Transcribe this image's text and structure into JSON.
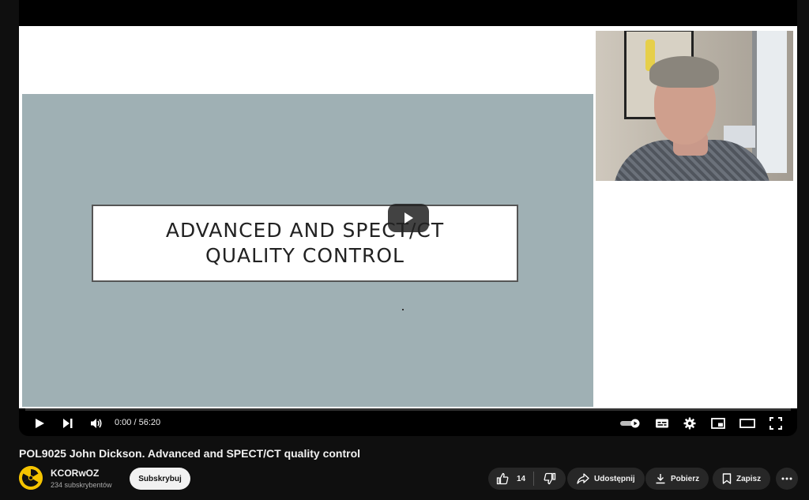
{
  "player": {
    "slide": {
      "title_line1": "ADVANCED AND SPECT/CT",
      "title_line2": "QUALITY CONTROL"
    },
    "progress": 0.0,
    "time": {
      "current": "0:00",
      "separator": " / ",
      "duration": "56:20"
    },
    "icons": {
      "play": "play-icon",
      "next": "skip-next-icon",
      "volume": "volume-icon",
      "autoplay": "autoplay-toggle-icon",
      "subtitles": "subtitles-icon",
      "settings": "gear-icon",
      "miniplayer": "miniplayer-icon",
      "theater": "theater-mode-icon",
      "fullscreen": "fullscreen-icon"
    }
  },
  "video": {
    "title": "POL9025 John Dickson. Advanced and SPECT/CT quality control"
  },
  "channel": {
    "name": "KCORwOZ",
    "subscribers": "234 subskrybentów",
    "subscribe_label": "Subskrybuj",
    "avatar_icon": "radiation-icon"
  },
  "actions": {
    "likes": "14",
    "share_label": "Udostępnij",
    "download_label": "Pobierz",
    "save_label": "Zapisz"
  },
  "colors": {
    "background": "#0f0f0f",
    "button_bg": "#272727",
    "accent_red": "#ff0000",
    "avatar_yellow": "#f5c400",
    "slide_bg": "#9fb0b4"
  }
}
